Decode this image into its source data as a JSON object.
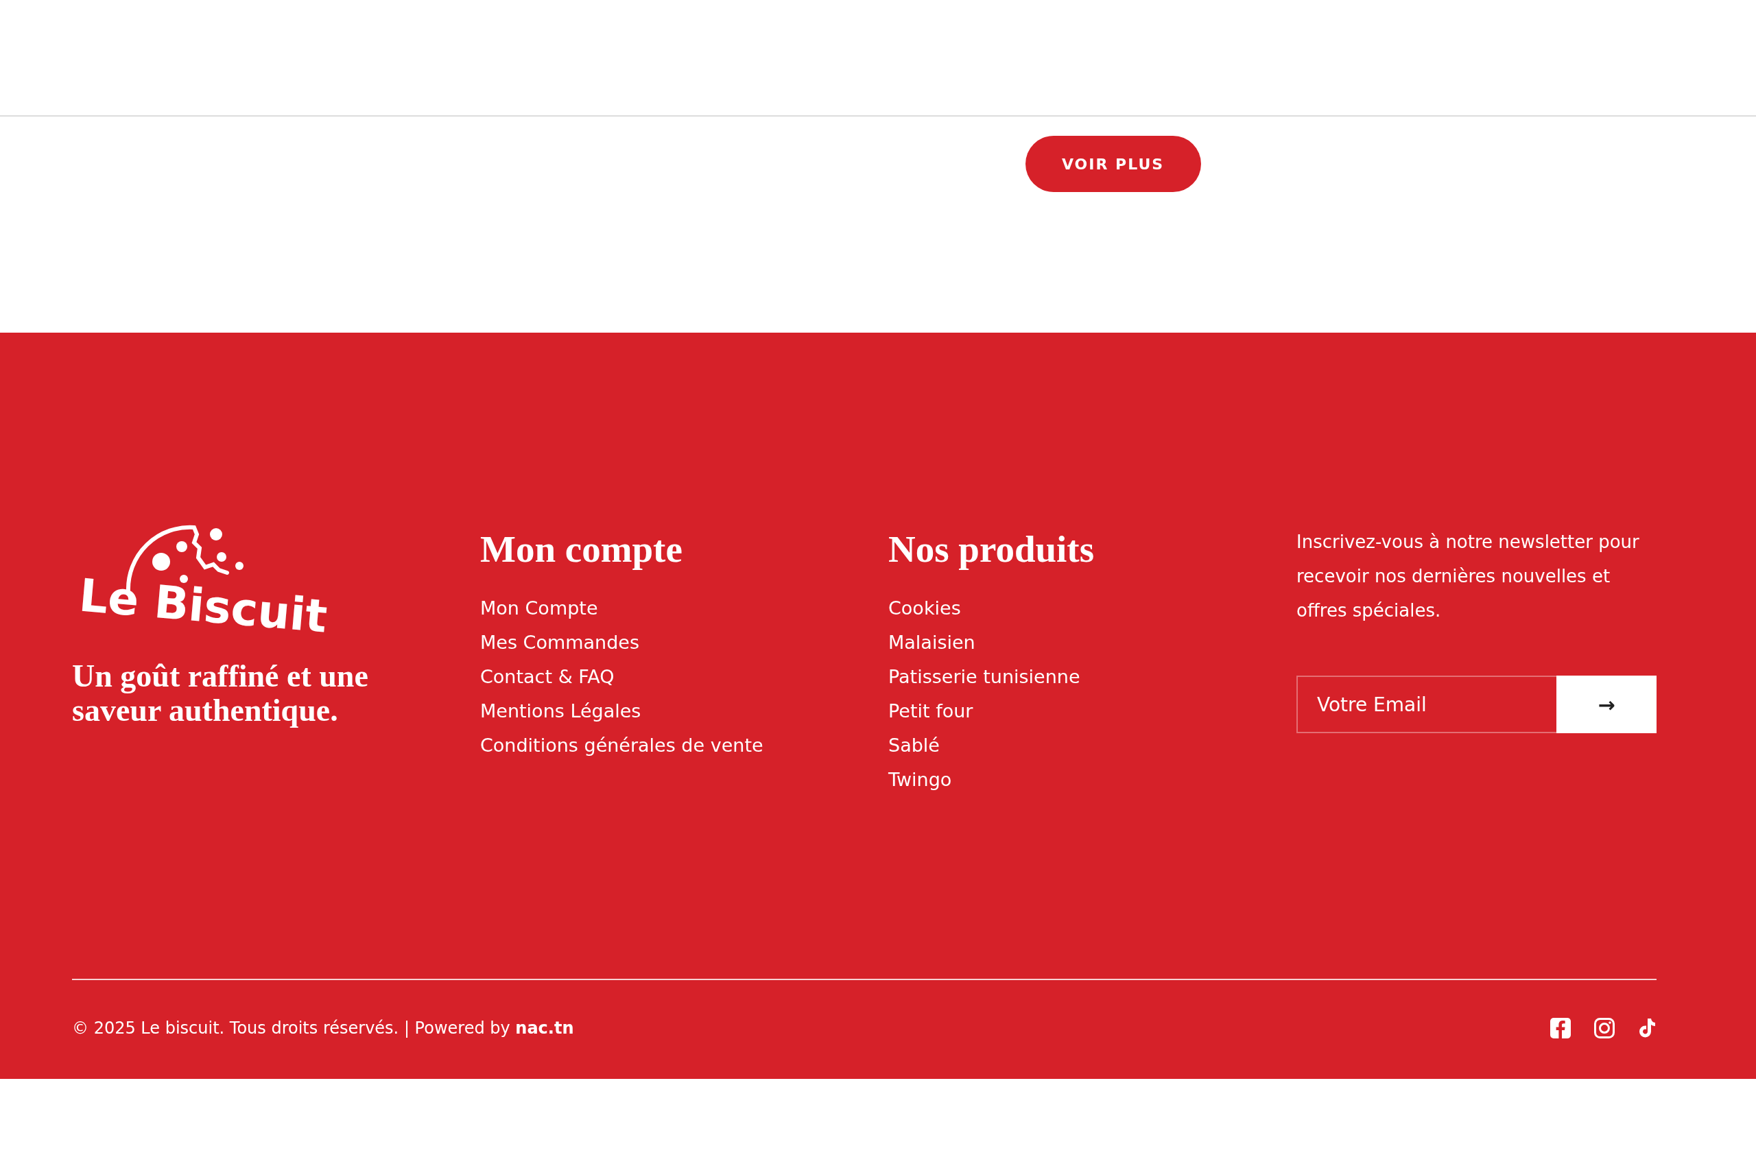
{
  "more_button": {
    "label": "VOIR PLUS"
  },
  "footer": {
    "brand": {
      "logo_text": "Le Biscuit",
      "tagline": "Un goût raffiné et une saveur authentique."
    },
    "columns": [
      {
        "title": "Mon compte",
        "links": [
          "Mon Compte",
          "Mes Commandes",
          "Contact & FAQ",
          "Mentions Légales",
          "Conditions générales de vente"
        ]
      },
      {
        "title": "Nos produits",
        "links": [
          "Cookies",
          "Malaisien",
          "Patisserie tunisienne",
          "Petit four",
          "Sablé",
          "Twingo"
        ]
      }
    ],
    "newsletter": {
      "text": "Inscrivez-vous à notre newsletter pour recevoir nos dernières nouvelles et offres spéciales.",
      "placeholder": "Votre Email",
      "submit": "→"
    },
    "copyright": "© 2025 Le biscuit. Tous droits réservés. | Powered by **nac.tn**",
    "social": [
      {
        "kind": "facebook"
      },
      {
        "kind": "instagram"
      },
      {
        "kind": "tiktok"
      }
    ]
  }
}
